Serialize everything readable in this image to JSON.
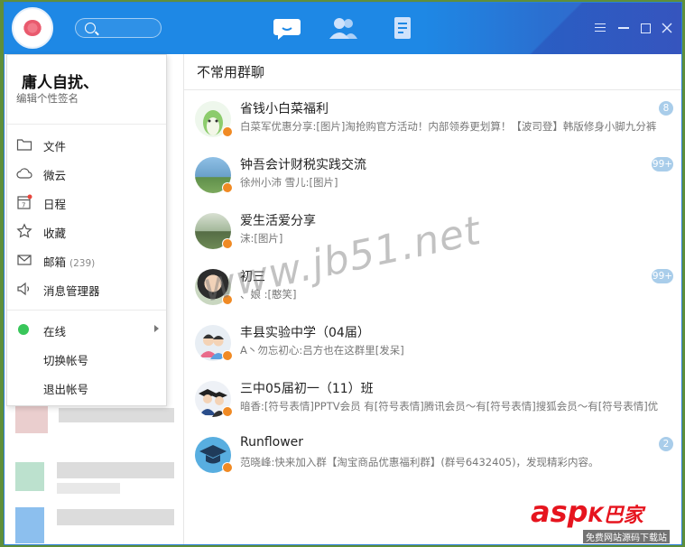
{
  "user": {
    "name": "庸人自扰、",
    "signature_placeholder": "编辑个性签名"
  },
  "menu": {
    "items": [
      {
        "label": "文件",
        "icon": "folder-icon"
      },
      {
        "label": "微云",
        "icon": "cloud-icon"
      },
      {
        "label": "日程",
        "icon": "calendar-icon",
        "badge_dot": true
      },
      {
        "label": "收藏",
        "icon": "star-icon"
      },
      {
        "label": "邮箱",
        "icon": "mail-icon",
        "count": "(239)"
      },
      {
        "label": "消息管理器",
        "icon": "speaker-icon"
      }
    ],
    "status": {
      "label": "在线",
      "icon": "online-status-dot"
    },
    "switch_account": "切换帐号",
    "logout": "退出帐号"
  },
  "group_section": {
    "title": "不常用群聊",
    "groups": [
      {
        "name": "省钱小白菜福利",
        "message": "白菜军优惠分享:[图片]淘抢购官方活动！内部领券更划算！【波司登】韩版修身小脚九分裤",
        "count": "8"
      },
      {
        "name": "钟吾会计财税实践交流",
        "message": "徐州小沛  雪儿:[图片]",
        "count": "99+"
      },
      {
        "name": "爱生活爱分享",
        "message": "沫:[图片]",
        "count": ""
      },
      {
        "name": "初三",
        "message": "、娘  :[憨笑]",
        "count": "99+"
      },
      {
        "name": "丰县实验中学（04届）",
        "message": "A丶勿忘初心:吕方也在这群里[发呆]",
        "count": ""
      },
      {
        "name": "三中05届初一（11）班",
        "message": "暗香:[符号表情]PPTV会员 有[符号表情]腾讯会员～有[符号表情]搜狐会员～有[符号表情]优",
        "count": ""
      },
      {
        "name": "Runflower",
        "message": "范晓峰:快来加入群【淘宝商品优惠福利群】(群号6432405)，发现精彩内容。",
        "count": "2"
      }
    ]
  },
  "watermark": "www.jb51.net",
  "brand": {
    "main": "asp",
    "cn": "K巴家",
    "sub": "免费网站源码下载站"
  }
}
